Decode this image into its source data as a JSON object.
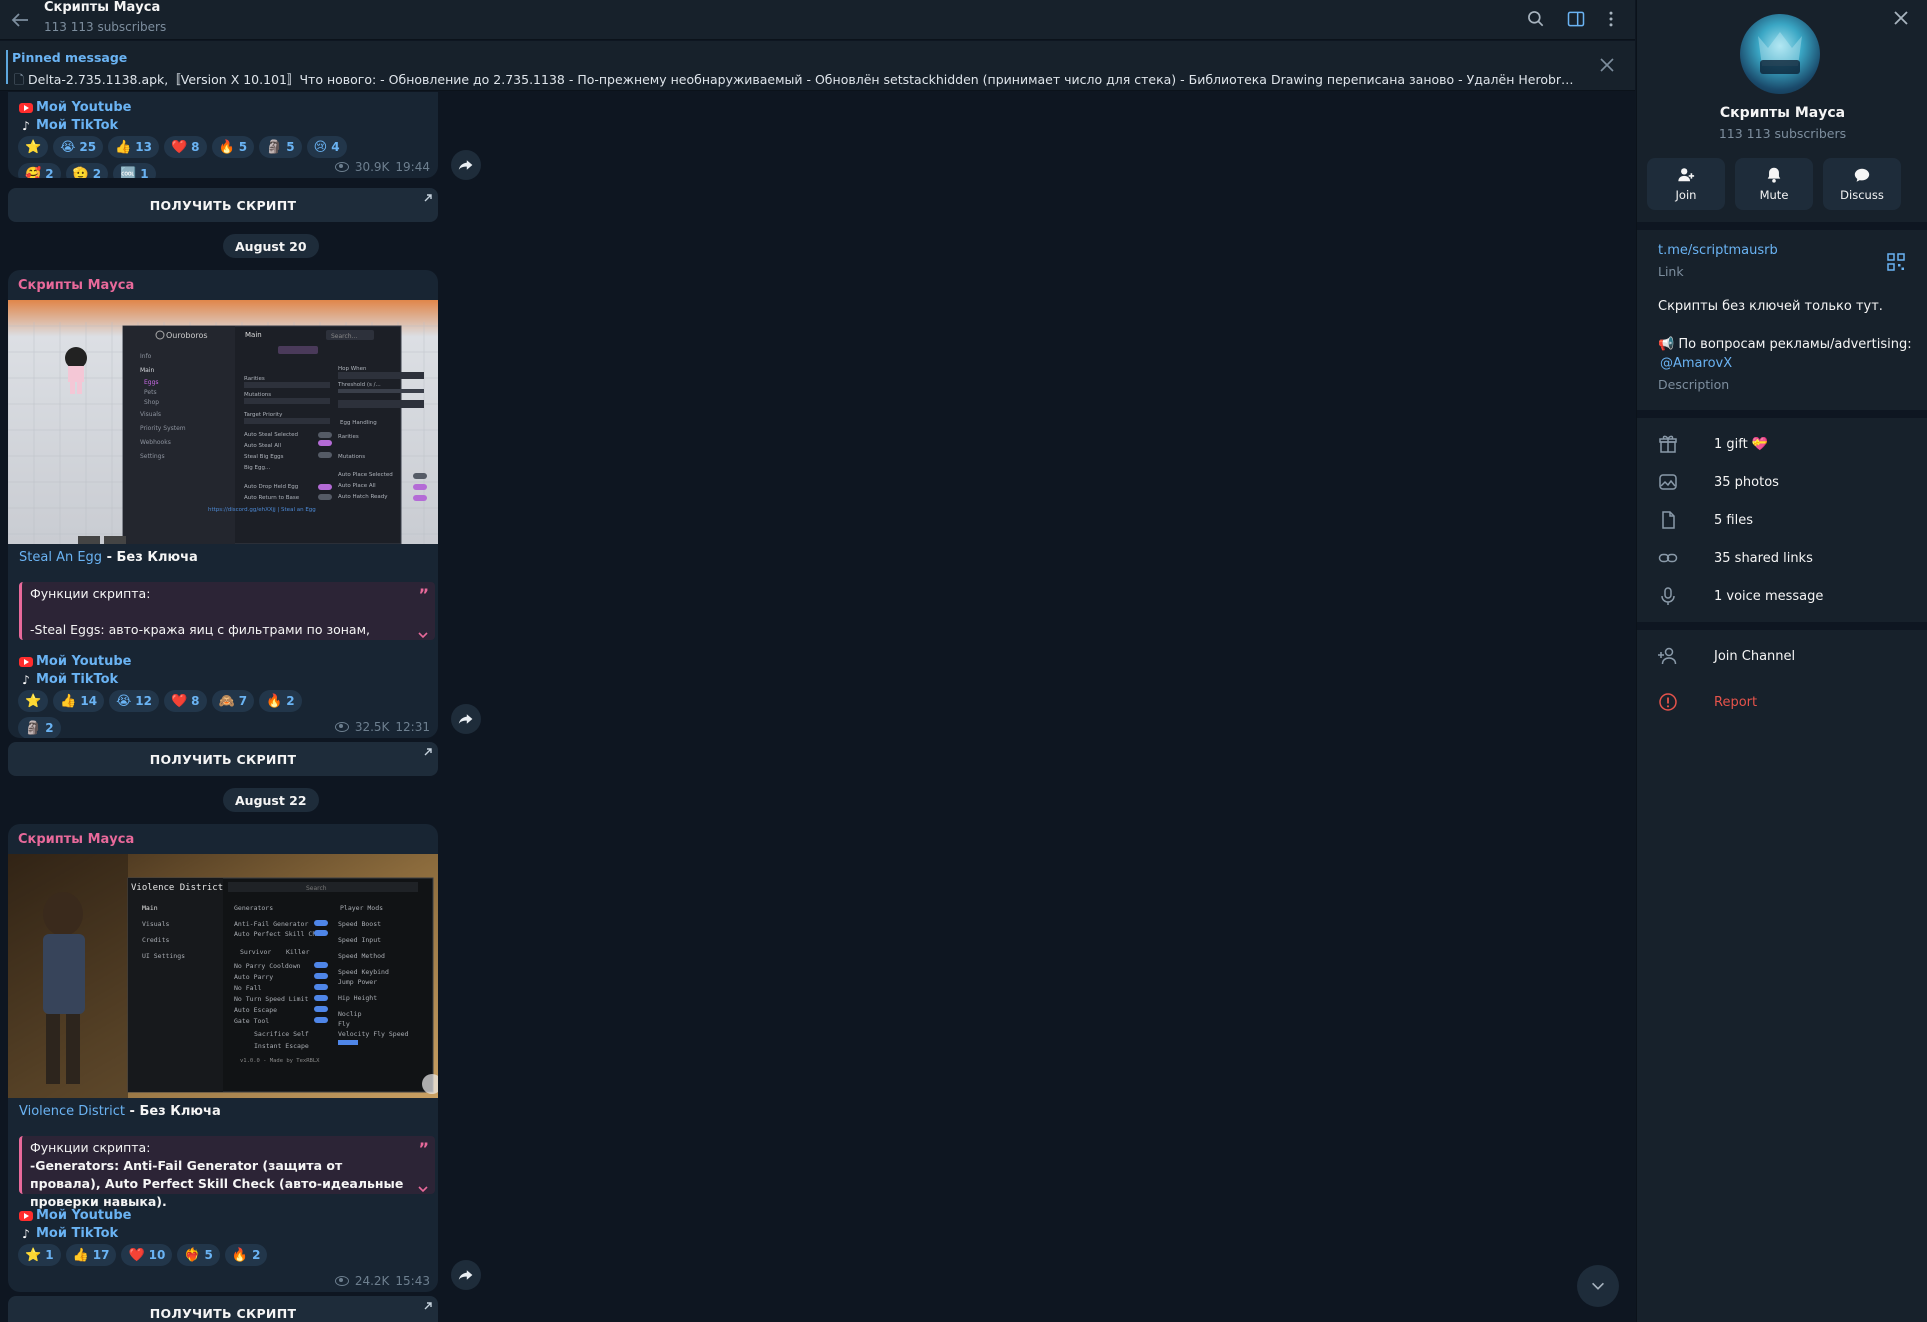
{
  "header": {
    "title": "Скрипты Мауса",
    "subscribers": "113 113 subscribers"
  },
  "pinned": {
    "label": "Pinned message",
    "text": "Delta-2.735.1138.apk,〚Version X 10.101〛Что нового: - Обновление до 2.735.1138 - По-прежнему необнаруживаемый - Обновлён setstackhidden (принимает число для стека) - Библиотека Drawing переписана заново - Удалён Herobrine - Добавлен g..."
  },
  "posts": [
    {
      "youtube": "Мой Youtube",
      "tiktok": "Мой TikTok",
      "reactions": [
        {
          "emoji": "⭐",
          "count": ""
        },
        {
          "emoji": "😭",
          "count": "25"
        },
        {
          "emoji": "👍",
          "count": "13"
        },
        {
          "emoji": "❤️",
          "count": "8"
        },
        {
          "emoji": "🔥",
          "count": "5"
        },
        {
          "emoji": "🗿",
          "count": "5"
        },
        {
          "emoji": "😢",
          "count": "4"
        },
        {
          "emoji": "🥰",
          "count": "2"
        },
        {
          "emoji": "🫡",
          "count": "2"
        },
        {
          "emoji": "🆒",
          "count": "1"
        }
      ],
      "views": "30.9K",
      "time": "19:44",
      "button": "ПОЛУЧИТЬ СКРИПТ"
    },
    {
      "date": "August 20",
      "sender": "Скрипты Мауса",
      "caption_link1": "Steal",
      "caption_link2": "An Egg",
      "caption_rest": " - Без Ключа",
      "quote_line1": "Функции скрипта:",
      "quote_line2": "-Steal Eggs: авто-кража яиц с фильтрами по зонам,",
      "youtube": "Мой Youtube",
      "tiktok": "Мой TikTok",
      "reactions": [
        {
          "emoji": "⭐",
          "count": ""
        },
        {
          "emoji": "👍",
          "count": "14"
        },
        {
          "emoji": "😭",
          "count": "12"
        },
        {
          "emoji": "❤️",
          "count": "8"
        },
        {
          "emoji": "🙈",
          "count": "7"
        },
        {
          "emoji": "🔥",
          "count": "2"
        },
        {
          "emoji": "🗿",
          "count": "2"
        }
      ],
      "views": "32.5K",
      "time": "12:31",
      "button": "ПОЛУЧИТЬ СКРИПТ",
      "ui_mock": {
        "app": "Ouroboros",
        "tab": "Main",
        "search": "Search...",
        "nav": [
          "Info",
          "Main",
          "Eggs",
          "Pets",
          "Shop",
          "Visuals",
          "Priority System",
          "Webhooks",
          "Settings"
        ],
        "chips": [
          "Eggs",
          "Pets",
          "Shop"
        ],
        "left_rows": [
          "Rarities",
          "Mutations",
          "Target Priority",
          "Auto Steal Selected",
          "Auto Steal All",
          "Steal Big Eggs",
          "Big Egg...",
          "Auto Drop Held Egg",
          "Auto Return to Base"
        ],
        "right_rows": [
          "Hop When",
          "No Matching Eggs",
          "Threshold (s /...",
          "Hop Now",
          "Egg Handling",
          "Rarities",
          "Mutations",
          "Auto Place Selected",
          "Auto Place All",
          "Auto Hatch Ready"
        ],
        "footer": "https://discord.gg/ehXXjj | Steal an Egg"
      }
    },
    {
      "date": "August 22",
      "sender": "Скрипты Мауса",
      "caption_link": "Violence District",
      "caption_rest": " - Без Ключа",
      "quote_line1": "Функции скрипта:",
      "quote_line2": "-Generators: Anti-Fail Generator (защита от провала), Auto Perfect Skill Check (авто-идеальные проверки навыка).",
      "youtube": "Мой Youtube",
      "tiktok": "Мой TikTok",
      "reactions": [
        {
          "emoji": "⭐",
          "count": "1"
        },
        {
          "emoji": "👍",
          "count": "17"
        },
        {
          "emoji": "❤️",
          "count": "10"
        },
        {
          "emoji": "❤️‍🔥",
          "count": "5"
        },
        {
          "emoji": "🔥",
          "count": "2"
        }
      ],
      "views": "24.2K",
      "time": "15:43",
      "button": "ПОЛУЧИТЬ СКРИПТ",
      "ui_mock": {
        "app": "Violence District",
        "search": "Search",
        "nav": [
          "Main",
          "Visuals",
          "Credits",
          "UI Settings"
        ],
        "dropdown1": "Generators",
        "dropdown2": "Player Mods",
        "left_rows": [
          "Anti-Fail Generator",
          "Auto Perfect Skill Ch",
          "No Parry Cooldown",
          "Auto Parry",
          "No Fall",
          "No Turn Speed Limit",
          "Auto Escape",
          "Gate Tool"
        ],
        "role_tabs": [
          "Survivor",
          "Killer"
        ],
        "buttons": [
          "Sacrifice Self",
          "Instant Escape"
        ],
        "right_rows": [
          "Speed Boost",
          "Speed Input",
          "Speed Method",
          "Speed Keybind",
          "Jump Power",
          "Hip Height",
          "Noclip",
          "Fly",
          "Velocity Fly Speed"
        ],
        "values": [
          "0/50",
          "Enter speed value here",
          "TP",
          "50/500",
          "0/20",
          "100/500"
        ],
        "footer": "v1.0.0 - Made by TexRBLX"
      }
    }
  ],
  "panel": {
    "title": "Скрипты Мауса",
    "subscribers": "113 113 subscribers",
    "actions": [
      "Join",
      "Mute",
      "Discuss"
    ],
    "link": "t.me/scriptmausrb",
    "link_label": "Link",
    "desc_line1": "Скрипты без ключей только тут.",
    "desc_line2": "📢 По вопросам рекламы/advertising:",
    "mention": "@AmarovX",
    "desc_label": "Description",
    "stats": [
      "1 gift 💝",
      "35 photos",
      "5 files",
      "35 shared links",
      "1 voice message"
    ],
    "join": "Join Channel",
    "report": "Report"
  },
  "colors": {
    "background": "#0e1621",
    "panel": "#17212b",
    "bubble": "#182533",
    "accent": "#6ab3f3",
    "sender": "#e8699a",
    "danger": "#e5534b"
  }
}
